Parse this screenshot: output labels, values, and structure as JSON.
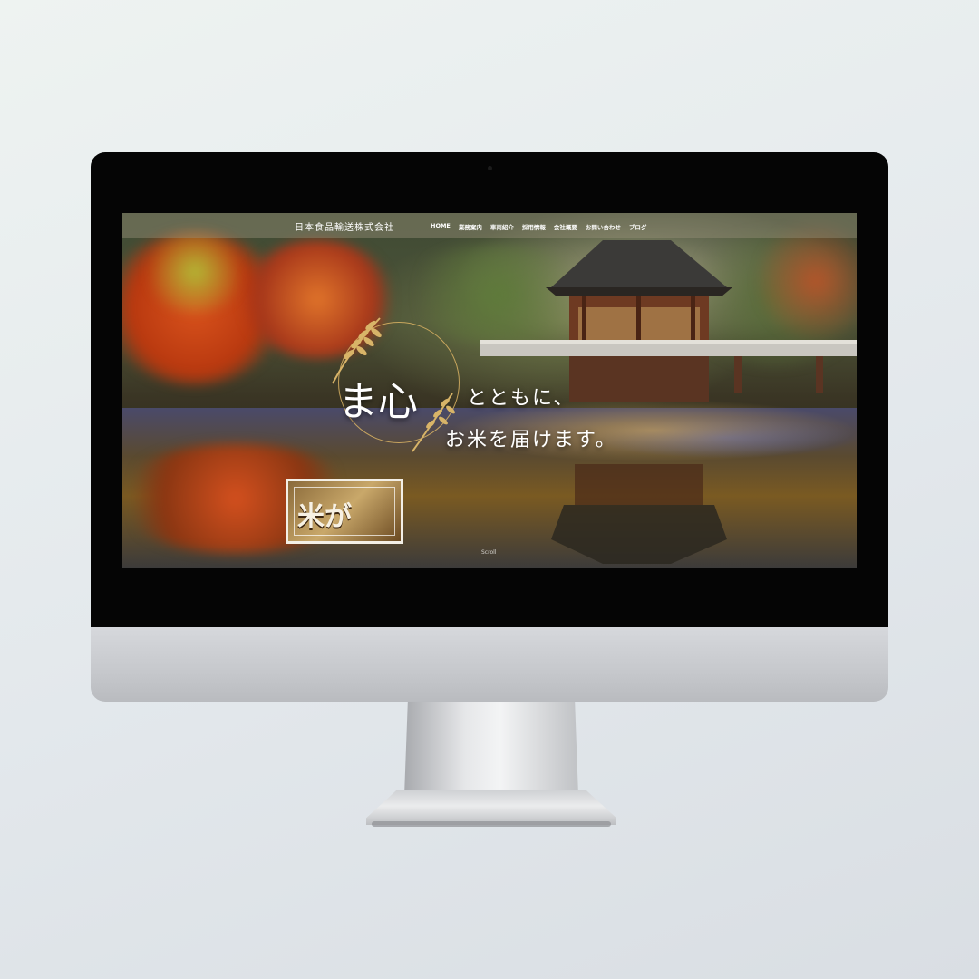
{
  "header": {
    "company_name": "日本食品輸送株式会社",
    "nav": [
      "HOME",
      "業務案内",
      "車両紹介",
      "採用情報",
      "会社概要",
      "お問い合わせ",
      "ブログ"
    ]
  },
  "hero": {
    "catch_big": "ま心",
    "catch_line1": "とともに、",
    "catch_line2": "お米を届けます。",
    "logo_text": "米が",
    "scroll_hint": "Scroll"
  },
  "colors": {
    "accent_gold": "#c9a86a",
    "nav_bg": "#968f78",
    "text_white": "#ffffff"
  },
  "icons": [
    "camera-icon",
    "rice-ear-icon"
  ]
}
